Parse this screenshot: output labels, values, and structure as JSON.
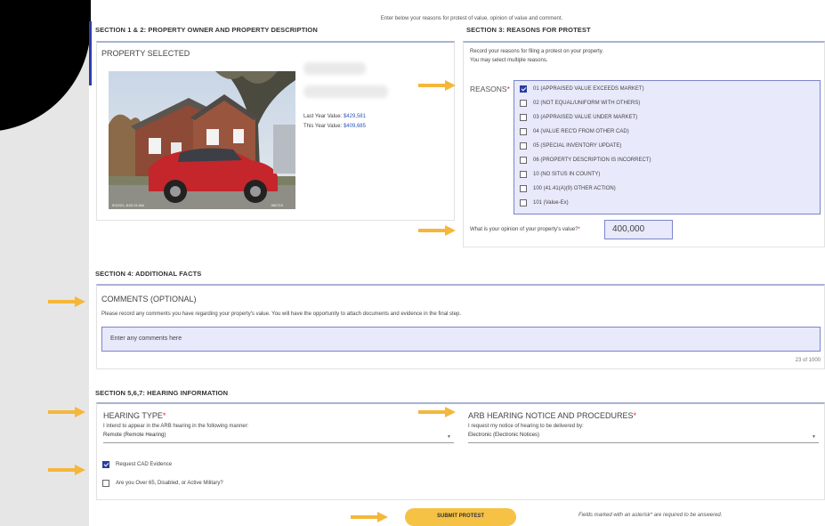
{
  "header": {
    "hint": "Enter below your reasons for protest of value, opinion of value and comment."
  },
  "section12": {
    "title": "SECTION 1 & 2: PROPERTY OWNER AND PROPERTY DESCRIPTION",
    "property_selected": "PROPERTY SELECTED",
    "last_year_label": "Last Year Value:",
    "last_year_value": "$429,581",
    "this_year_label": "This Year Value:",
    "this_year_value": "$409,685",
    "photo_timestamp": "9/12/21, 8:02:21 AM",
    "photo_code": "062719"
  },
  "section3": {
    "title": "SECTION 3: REASONS FOR PROTEST",
    "intro1": "Record your reasons for filing a protest on your property.",
    "intro2": "You may select multiple reasons.",
    "reasons_label": "REASONS",
    "reasons": [
      {
        "label": "01 (APPRAISED VALUE EXCEEDS MARKET)",
        "checked": true
      },
      {
        "label": "02 (NOT EQUAL/UNIFORM WITH OTHERS)",
        "checked": false
      },
      {
        "label": "03 (APPRAISED VALUE UNDER MARKET)",
        "checked": false
      },
      {
        "label": "04 (VALUE REC'D FROM OTHER CAD)",
        "checked": false
      },
      {
        "label": "05 (SPECIAL INVENTORY UPDATE)",
        "checked": false
      },
      {
        "label": "06 (PROPERTY DESCRIPTION IS INCORRECT)",
        "checked": false
      },
      {
        "label": "10 (NO SITUS IN COUNTY)",
        "checked": false
      },
      {
        "label": "100 (41.41(A)(9) OTHER ACTION)",
        "checked": false
      },
      {
        "label": "101 (Value-Ex)",
        "checked": false
      }
    ],
    "opinion_question": "What is your opinion of your property's value?",
    "opinion_value": "400,000"
  },
  "section4": {
    "title": "SECTION 4: ADDITIONAL FACTS",
    "comments_label": "COMMENTS (OPTIONAL)",
    "comments_help": "Please record any comments you have regarding your property's value. You will have the opportunity to attach documents and evidence in the final step.",
    "comments_placeholder": "Enter any comments here",
    "char_count": "23 of 1000"
  },
  "section567": {
    "title": "SECTION 5,6,7: HEARING INFORMATION",
    "hearing_type_label": "HEARING TYPE",
    "hearing_type_help": "I intend to appear in the ARB hearing in the following manner:",
    "hearing_type_value": "Remote (Remote Hearing)",
    "notice_label": "ARB HEARING NOTICE AND PROCEDURES",
    "notice_help": "I request my notice of hearing to be delivered by:",
    "notice_value": "Electronic (Electronic Notices)",
    "request_cad_label": "Request CAD Evidence",
    "request_cad_checked": true,
    "over65_label": "Are you Over 65, Disabled, or Active Military?",
    "over65_checked": false
  },
  "footer": {
    "submit_label": "SUBMIT PROTEST",
    "required_note": "Fields marked with an asterisk* are required to be answered."
  },
  "colors": {
    "accent": "#2b3fa8",
    "link_blue": "#2e56b8",
    "field_fill": "#e8e9fb",
    "arrow": "#f5b73a",
    "submit": "#f6c245",
    "required": "#d0304a"
  },
  "required_mark": "*"
}
